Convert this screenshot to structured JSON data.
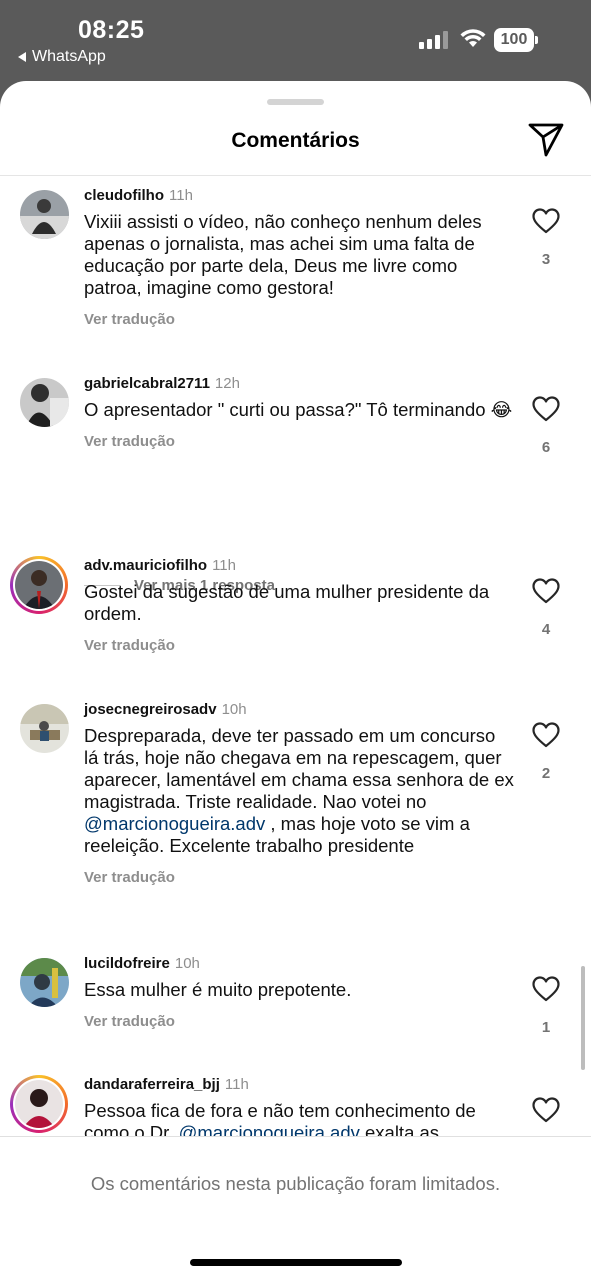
{
  "status_bar": {
    "time": "08:25",
    "back_app": "WhatsApp",
    "battery": "100"
  },
  "header": {
    "title": "Comentários"
  },
  "comments": [
    {
      "username": "cleudofilho",
      "time": "11h",
      "text": "Vixiii assisti o vídeo, não conheço nenhum deles apenas o jornalista, mas achei sim uma falta de educação por parte dela,  Deus me livre como patroa, imagine como gestora!",
      "translate": "Ver tradução",
      "likes": "3"
    },
    {
      "username": "gabrielcabral2711",
      "time": "12h",
      "text": "O apresentador \" curti ou passa?\" Tô terminando 😂",
      "translate": "Ver tradução",
      "likes": "6",
      "more_replies": "Ver mais 1 resposta"
    },
    {
      "username": "adv.mauriciofilho",
      "time": "11h",
      "text": "Gostei da sugestão de uma mulher presidente da ordem.",
      "translate": "Ver tradução",
      "likes": "4"
    },
    {
      "username": "josecnegreirosadv",
      "time": "10h",
      "text_before": "Despreparada, deve ter passado em um concurso lá trás, hoje não chegava em na repescagem,  quer aparecer, lamentável em chama essa senhora de ex magistrada. Triste realidade. Nao votei no ",
      "mention": "@marcionogueira.adv",
      "text_after": " , mas hoje voto se vim a reeleição. Excelente trabalho presidente",
      "translate": "Ver tradução",
      "likes": "2"
    },
    {
      "username": "lucildofreire",
      "time": "10h",
      "text": "Essa mulher é muito prepotente.",
      "translate": "Ver tradução",
      "likes": "1"
    },
    {
      "username": "dandaraferreira_bjj",
      "time": "11h",
      "text_before": "Pessoa fica de fora e não tem conhecimento de como o Dr. ",
      "mention": "@marcionogueira.adv",
      "text_after": " exalta as"
    }
  ],
  "footer": {
    "limited_text": "Os comentários nesta publicação foram limitados."
  }
}
